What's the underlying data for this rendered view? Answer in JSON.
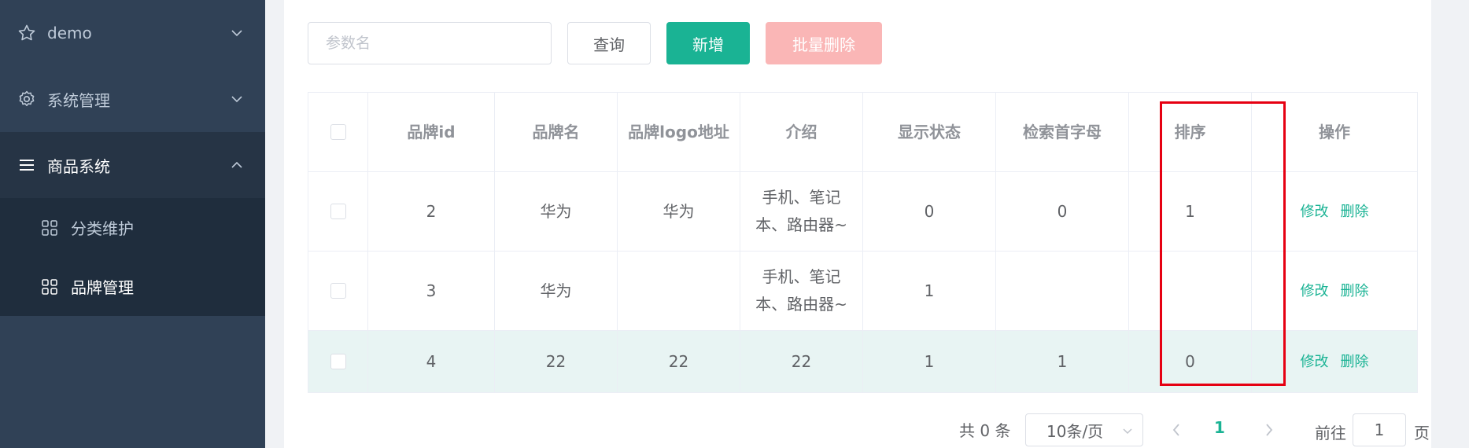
{
  "sidebar": {
    "items": [
      {
        "label": "demo",
        "icon": "star-icon"
      },
      {
        "label": "系统管理",
        "icon": "gear-icon"
      },
      {
        "label": "商品系统",
        "icon": "menu-icon"
      }
    ],
    "submenu": [
      {
        "label": "分类维护",
        "icon": "grid-icon"
      },
      {
        "label": "品牌管理",
        "icon": "grid-icon",
        "active": true
      }
    ]
  },
  "toolbar": {
    "search_placeholder": "参数名",
    "search_value": "",
    "query_label": "查询",
    "add_label": "新增",
    "batch_delete_label": "批量删除"
  },
  "table": {
    "columns": [
      "品牌id",
      "品牌名",
      "品牌logo地址",
      "介绍",
      "显示状态",
      "检索首字母",
      "排序",
      "操作"
    ],
    "rows": [
      {
        "id": "2",
        "name": "华为",
        "logo": "华为",
        "intro": "手机、笔记本、路由器~",
        "status": "0",
        "first_letter": "0",
        "sort": "1",
        "edit": "修改",
        "delete": "删除"
      },
      {
        "id": "3",
        "name": "华为",
        "logo": "",
        "intro": "手机、笔记本、路由器~",
        "status": "1",
        "first_letter": "",
        "sort": "",
        "edit": "修改",
        "delete": "删除"
      },
      {
        "id": "4",
        "name": "22",
        "logo": "22",
        "intro": "22",
        "status": "1",
        "first_letter": "1",
        "sort": "0",
        "edit": "修改",
        "delete": "删除"
      }
    ]
  },
  "pagination": {
    "total_text": "共 0 条",
    "page_size": "10条/页",
    "current_page": "1",
    "goto_label": "前往",
    "goto_value": "1",
    "goto_suffix": "页"
  },
  "colors": {
    "sidebar_bg": "#304156",
    "accent": "#1ab394",
    "danger_disabled": "#fab6b6",
    "highlight": "#e60012"
  }
}
